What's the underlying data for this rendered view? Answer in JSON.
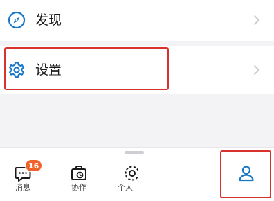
{
  "menu": {
    "discover": {
      "label": "发现",
      "icon": "compass-icon"
    },
    "settings": {
      "label": "设置",
      "icon": "gear-icon"
    }
  },
  "tabbar": {
    "tabs": [
      {
        "label": "消息",
        "icon": "message-icon",
        "badge": "16"
      },
      {
        "label": "协作",
        "icon": "collaboration-icon"
      },
      {
        "label": "个人",
        "icon": "personal-space-icon"
      },
      {
        "label": "",
        "icon": "user-icon",
        "selected": true
      }
    ]
  },
  "colors": {
    "accent": "#1677c8",
    "badge": "#f0622b",
    "highlight": "#d8322d"
  }
}
